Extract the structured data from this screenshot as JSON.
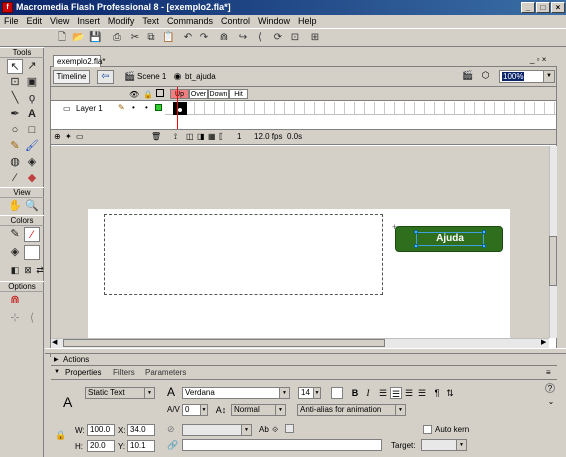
{
  "window": {
    "title": "Macromedia Flash Professional 8 - [exemplo2.fla*]",
    "controls": [
      "_",
      "□",
      "×"
    ]
  },
  "menu": [
    "File",
    "Edit",
    "View",
    "Insert",
    "Modify",
    "Text",
    "Commands",
    "Control",
    "Window",
    "Help"
  ],
  "tools": {
    "header": "Tools",
    "view_header": "View",
    "colors_header": "Colors",
    "options_header": "Options"
  },
  "document": {
    "tab": "exemplo2.fla*",
    "timeline_button": "Timeline",
    "breadcrumb_scene": "Scene 1",
    "breadcrumb_symbol": "bt_ajuda",
    "zoom": "100%"
  },
  "timeline": {
    "frame_labels": [
      "Up",
      "Over",
      "Down",
      "Hit"
    ],
    "layer_name": "Layer 1",
    "current_frame": "1",
    "fps": "12.0 fps",
    "elapsed": "0.0s"
  },
  "stage": {
    "button_label": "Ajuda",
    "button_color": "#2e6e1c"
  },
  "panels": {
    "actions": "Actions",
    "tabs": [
      "Properties",
      "Filters",
      "Parameters"
    ],
    "text_type": "Static Text",
    "font": "Verdana",
    "font_size": "14",
    "letter_spacing": "0",
    "position_mode": "Normal",
    "antialias": "Anti-alias for animation",
    "w_label": "W:",
    "w": "100.0",
    "h_label": "H:",
    "h": "20.0",
    "x_label": "X:",
    "x": "34.0",
    "y_label": "Y:",
    "y": "10.1",
    "auto_kern": "Auto kern",
    "target_label": "Target:"
  }
}
